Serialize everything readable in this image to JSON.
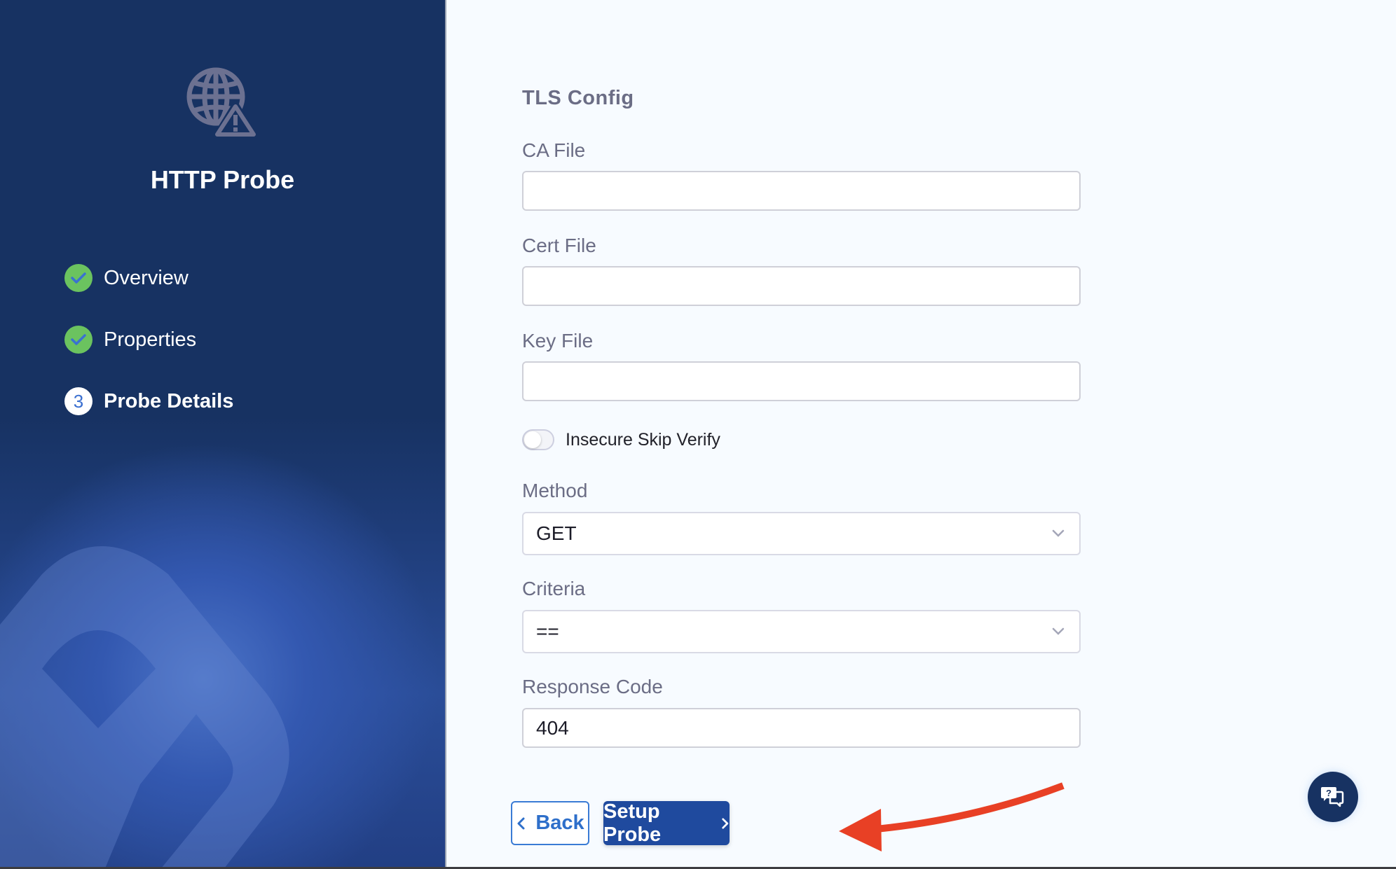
{
  "sidebar": {
    "title": "HTTP Probe",
    "icon": "globe-warning-icon",
    "steps": [
      {
        "label": "Overview",
        "status": "done",
        "icon": "check-icon"
      },
      {
        "label": "Properties",
        "status": "done",
        "icon": "check-icon"
      },
      {
        "label": "Probe Details",
        "status": "current",
        "number": "3"
      }
    ]
  },
  "form": {
    "section_title": "TLS Config",
    "ca_file": {
      "label": "CA File",
      "value": ""
    },
    "cert_file": {
      "label": "Cert File",
      "value": ""
    },
    "key_file": {
      "label": "Key File",
      "value": ""
    },
    "insecure_skip_verify": {
      "label": "Insecure Skip Verify",
      "enabled": false
    },
    "method": {
      "label": "Method",
      "value": "GET"
    },
    "criteria": {
      "label": "Criteria",
      "value": "=="
    },
    "response_code": {
      "label": "Response Code",
      "value": "404"
    }
  },
  "actions": {
    "back_label": "Back",
    "setup_label": "Setup Probe"
  },
  "help": {
    "icon": "help-chat-icon"
  },
  "colors": {
    "sidebar_bg": "#173262",
    "primary": "#1f4a9e",
    "done_green": "#6bc35f",
    "annotation_arrow": "#e84025"
  }
}
